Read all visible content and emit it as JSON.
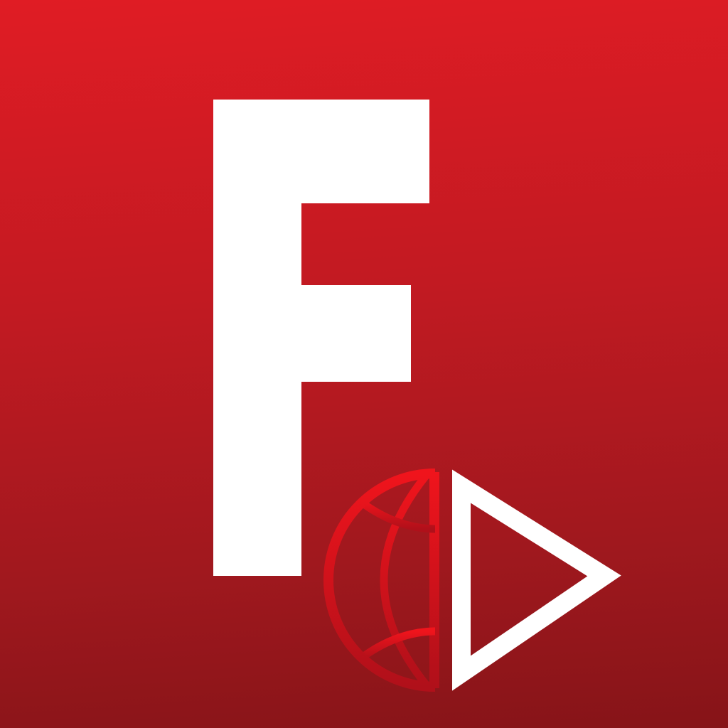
{
  "app_icon": {
    "letter": "F",
    "icons": {
      "globe": "globe-icon",
      "play": "play-icon"
    },
    "colors": {
      "background_top": "#e01c24",
      "background_bottom": "#861418",
      "letter": "#ffffff",
      "globe_light": "#f0141c",
      "globe_dark": "#b0101a",
      "play_outline": "#ffffff"
    }
  }
}
